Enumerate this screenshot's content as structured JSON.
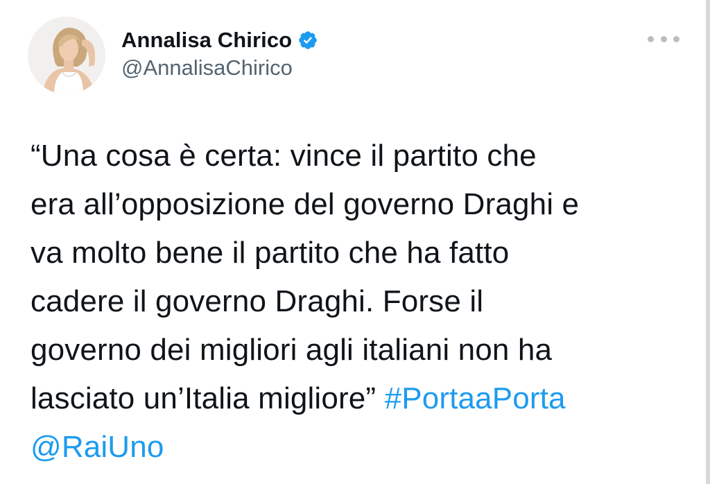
{
  "author": {
    "display_name": "Annalisa Chirico",
    "handle": "@AnnalisaChirico",
    "verified": true,
    "verified_icon": "verified-badge-icon",
    "avatar_icon": "profile-photo"
  },
  "menu_icon": "more-options-icon",
  "tweet": {
    "lines": [
      "“Una cosa è certa: vince il partito che",
      "era all’opposizione del governo Draghi e",
      "va molto bene il partito che ha fatto",
      "cadere il governo Draghi. Forse il",
      "governo dei migliori agli italiani non ha",
      "lasciato un’Italia migliore”"
    ],
    "hashtag": "#PortaaPorta",
    "mention": "@RaiUno"
  },
  "colors": {
    "link": "#1d9bf0",
    "text": "#0f1419",
    "secondary": "#536471",
    "verified": "#1d9bf0"
  }
}
